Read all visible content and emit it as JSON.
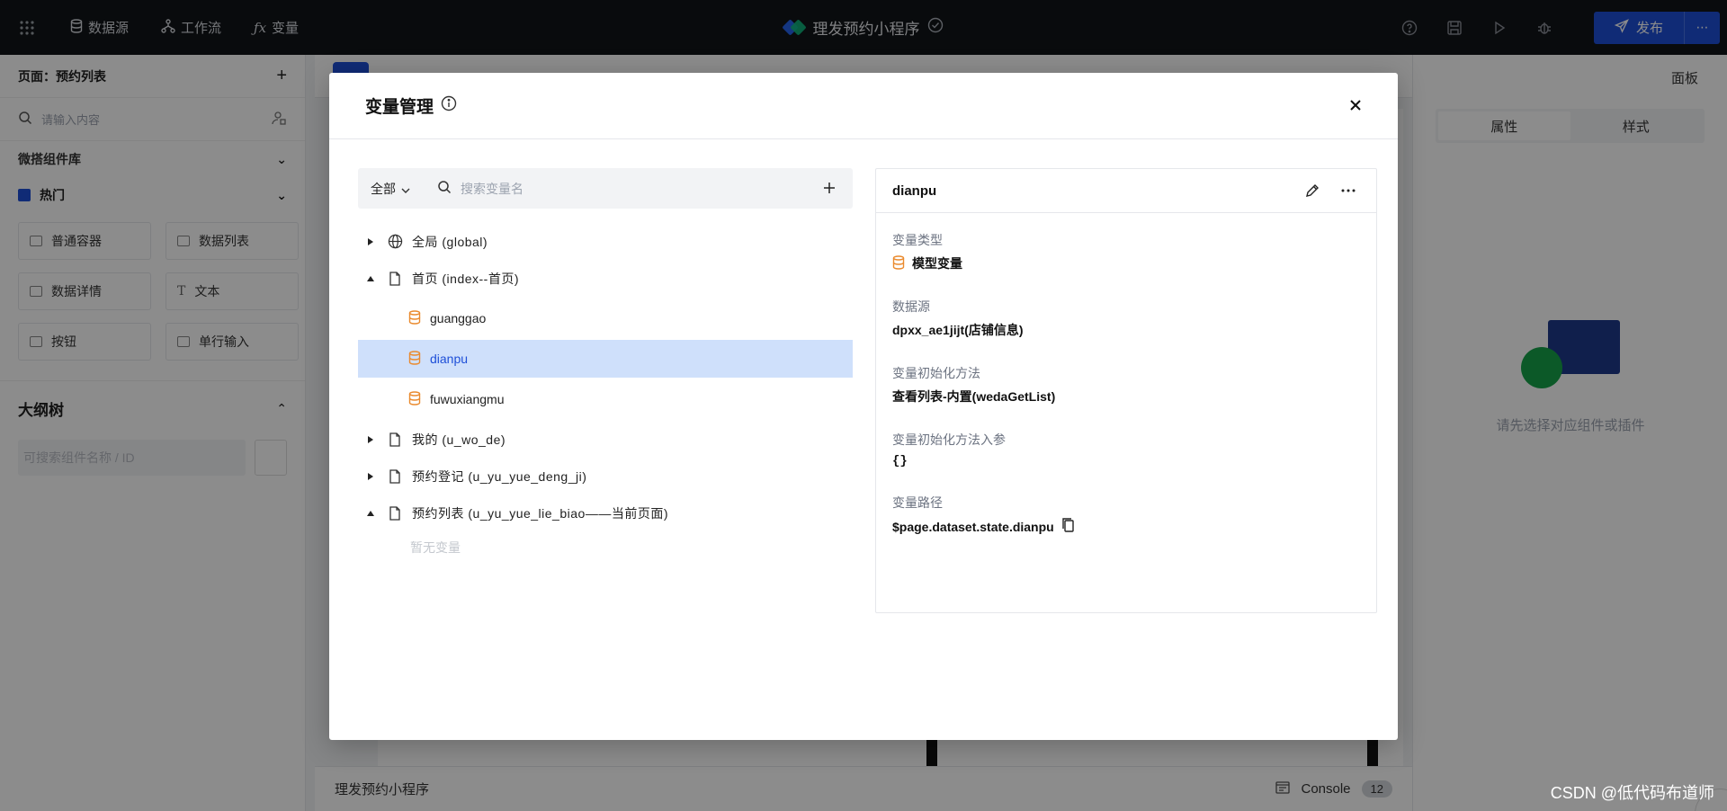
{
  "topbar": {
    "nav": [
      {
        "label": "数据源",
        "icon": "database-icon"
      },
      {
        "label": "工作流",
        "icon": "workflow-icon"
      },
      {
        "label": "变量",
        "icon": "function-icon"
      }
    ],
    "app_title": "理发预约小程序",
    "publish_label": "发布"
  },
  "left_panel": {
    "page_label": "页面：预约列表",
    "search_placeholder": "请输入内容",
    "library_title": "微搭组件库",
    "hot_title": "热门",
    "components": [
      "普通容器",
      "数据列表",
      "数据详情",
      "文本",
      "按钮",
      "单行输入"
    ],
    "outline_title": "大纲树",
    "outline_placeholder": "可搜索组件名称 / ID"
  },
  "right_panel": {
    "panel_title": "面板",
    "tabs": [
      "属性",
      "样式"
    ],
    "empty_text": "请先选择对应组件或插件"
  },
  "footer": {
    "app_name": "理发预约小程序",
    "console_label": "Console",
    "console_count": "12"
  },
  "watermark": "CSDN @低代码布道师",
  "modal": {
    "title": "变量管理",
    "filter_label": "全部",
    "search_placeholder": "搜索变量名",
    "tree": {
      "global": "全局 (global)",
      "index": "首页 (index--首页)",
      "index_vars": [
        "guanggao",
        "dianpu",
        "fuwuxiangmu"
      ],
      "wode": "我的 (u_wo_de)",
      "dengji": "预约登记 (u_yu_yue_deng_ji)",
      "liebiao": "预约列表 (u_yu_yue_lie_biao——当前页面)",
      "empty_text": "暂无变量"
    },
    "detail": {
      "name": "dianpu",
      "type_label": "变量类型",
      "type_value": "模型变量",
      "source_label": "数据源",
      "source_value": "dpxx_ae1jijt(店铺信息)",
      "init_label": "变量初始化方法",
      "init_value": "查看列表-内置(wedaGetList)",
      "param_label": "变量初始化方法入参",
      "param_value": "{}",
      "path_label": "变量路径",
      "path_value": "$page.dataset.state.dianpu"
    }
  }
}
